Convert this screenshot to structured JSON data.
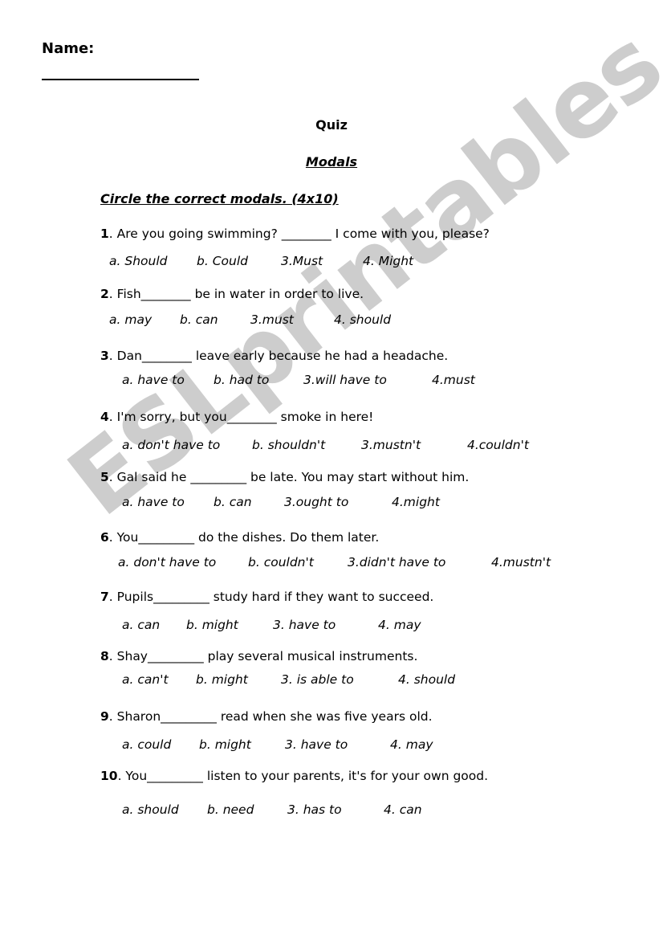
{
  "header": {
    "name_label": "Name:",
    "title": "Quiz",
    "subtitle": "Modals",
    "instructions": "Circle the correct modals. (4x10)"
  },
  "watermark": "ESLprintables.com",
  "questions": [
    {
      "num": "1",
      "text": ". Are you going swimming? ________ I come with you, please?",
      "options": [
        "a. Should",
        "b. Could",
        "3.Must",
        "4. Might"
      ]
    },
    {
      "num": "2",
      "text": ". Fish________  be in water in order to live.",
      "options": [
        "a. may",
        "b. can",
        "3.must",
        "4. should"
      ]
    },
    {
      "num": "3",
      "text": ". Dan________  leave early because he had a headache.",
      "options": [
        "a. have to",
        "b. had to",
        "3.will have to",
        "4.must"
      ]
    },
    {
      "num": "4",
      "text": ". I'm sorry, but you________ smoke in here!",
      "options": [
        "a. don't have to",
        "b. shouldn't",
        "3.mustn't",
        "4.couldn't"
      ]
    },
    {
      "num": "5",
      "text": ". Gal said he _________ be late. You may start without him.",
      "options": [
        "a. have to",
        "b. can",
        "3.ought to",
        "4.might"
      ]
    },
    {
      "num": "6",
      "text": ". You_________ do the dishes. Do them later.",
      "options": [
        "a. don't have to",
        "b. couldn't",
        "3.didn't have to",
        "4.mustn't"
      ]
    },
    {
      "num": "7",
      "text": ". Pupils_________ study hard if they want to succeed.",
      "options": [
        "a. can",
        "b. might",
        "3. have to",
        "4. may"
      ]
    },
    {
      "num": "8",
      "text": ". Shay_________ play several musical instruments.",
      "options": [
        "a. can't",
        "b. might",
        "3. is able to",
        "4. should"
      ]
    },
    {
      "num": "9",
      "text": ". Sharon_________ read when she was five years old.",
      "options": [
        "a. could",
        "b. might",
        "3. have to",
        "4. may"
      ]
    },
    {
      "num": "10",
      "text": ". You_________ listen to your parents, it's for your own good.",
      "options": [
        "a. should",
        "b. need",
        "3. has to",
        "4. can"
      ]
    }
  ]
}
